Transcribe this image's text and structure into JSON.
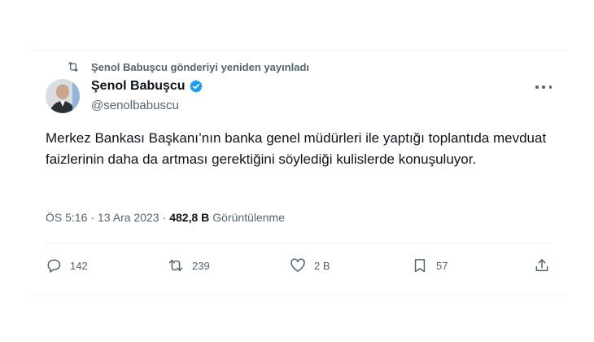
{
  "tweet": {
    "repost_label": "Şenol Babuşcu gönderiyi yeniden yayınladı",
    "author_name": "Şenol Babuşcu",
    "author_handle": "@senolbabuscu",
    "text": "Merkez Bankası Başkanı’nın banka genel müdürleri ile yaptığı toplantıda mevduat faizlerinin daha da artması gerektiğini söylediği kulislerde konuşuluyor.",
    "time": "ÖS 5:16",
    "separator": "·",
    "date": "13 Ara 2023",
    "views_count": "482,8 B",
    "views_label": "Görüntülenme"
  },
  "actions": {
    "replies": "142",
    "reposts": "239",
    "likes": "2 B",
    "bookmarks": "57"
  },
  "colors": {
    "text_primary": "#0f1419",
    "text_secondary": "#536471",
    "verified_blue": "#1d9bf0",
    "border": "#eff3f4"
  },
  "icons": [
    "repost-icon",
    "verified-badge-icon",
    "more-icon",
    "reply-icon",
    "repost-icon",
    "like-icon",
    "bookmark-icon",
    "share-icon"
  ]
}
